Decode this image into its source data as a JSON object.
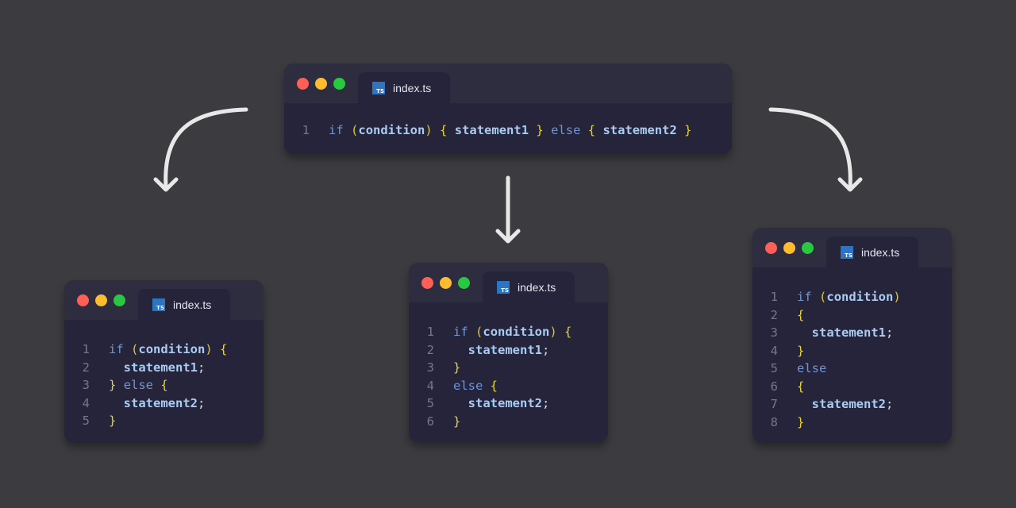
{
  "tab_label": "index.ts",
  "ts_badge": "TS",
  "source": {
    "lines": [
      {
        "n": "1",
        "kw1": "if",
        "p1": "(",
        "cond": "condition",
        "p2": ")",
        "b1": "{",
        "s1": "statement1",
        "b2": "}",
        "kw2": "else",
        "b3": "{",
        "s2": "statement2",
        "b4": "}"
      }
    ]
  },
  "styles": [
    {
      "lines": [
        {
          "n": "1",
          "tokens": [
            [
              "kw",
              "if"
            ],
            [
              "sp",
              " "
            ],
            [
              "paren",
              "("
            ],
            [
              "id",
              "condition"
            ],
            [
              "paren",
              ")"
            ],
            [
              "sp",
              " "
            ],
            [
              "brace",
              "{"
            ]
          ]
        },
        {
          "n": "2",
          "tokens": [
            [
              "sp",
              "  "
            ],
            [
              "id",
              "statement1"
            ],
            [
              "semi",
              ";"
            ]
          ]
        },
        {
          "n": "3",
          "tokens": [
            [
              "brace",
              "}"
            ],
            [
              "sp",
              " "
            ],
            [
              "kw",
              "else"
            ],
            [
              "sp",
              " "
            ],
            [
              "brace",
              "{"
            ]
          ]
        },
        {
          "n": "4",
          "tokens": [
            [
              "sp",
              "  "
            ],
            [
              "id",
              "statement2"
            ],
            [
              "semi",
              ";"
            ]
          ]
        },
        {
          "n": "5",
          "tokens": [
            [
              "brace",
              "}"
            ]
          ]
        }
      ]
    },
    {
      "lines": [
        {
          "n": "1",
          "tokens": [
            [
              "kw",
              "if"
            ],
            [
              "sp",
              " "
            ],
            [
              "paren",
              "("
            ],
            [
              "id",
              "condition"
            ],
            [
              "paren",
              ")"
            ],
            [
              "sp",
              " "
            ],
            [
              "brace",
              "{"
            ]
          ]
        },
        {
          "n": "2",
          "tokens": [
            [
              "sp",
              "  "
            ],
            [
              "id",
              "statement1"
            ],
            [
              "semi",
              ";"
            ]
          ]
        },
        {
          "n": "3",
          "tokens": [
            [
              "brace",
              "}"
            ]
          ]
        },
        {
          "n": "4",
          "tokens": [
            [
              "kw",
              "else"
            ],
            [
              "sp",
              " "
            ],
            [
              "brace",
              "{"
            ]
          ]
        },
        {
          "n": "5",
          "tokens": [
            [
              "sp",
              "  "
            ],
            [
              "id",
              "statement2"
            ],
            [
              "semi",
              ";"
            ]
          ]
        },
        {
          "n": "6",
          "tokens": [
            [
              "brace",
              "}"
            ]
          ]
        }
      ]
    },
    {
      "lines": [
        {
          "n": "1",
          "tokens": [
            [
              "kw",
              "if"
            ],
            [
              "sp",
              " "
            ],
            [
              "paren",
              "("
            ],
            [
              "id",
              "condition"
            ],
            [
              "paren",
              ")"
            ]
          ]
        },
        {
          "n": "2",
          "tokens": [
            [
              "brace",
              "{"
            ]
          ]
        },
        {
          "n": "3",
          "tokens": [
            [
              "sp",
              "  "
            ],
            [
              "id",
              "statement1"
            ],
            [
              "semi",
              ";"
            ]
          ]
        },
        {
          "n": "4",
          "tokens": [
            [
              "brace",
              "}"
            ]
          ]
        },
        {
          "n": "5",
          "tokens": [
            [
              "kw",
              "else"
            ]
          ]
        },
        {
          "n": "6",
          "tokens": [
            [
              "brace",
              "{"
            ]
          ]
        },
        {
          "n": "7",
          "tokens": [
            [
              "sp",
              "  "
            ],
            [
              "id",
              "statement2"
            ],
            [
              "semi",
              ";"
            ]
          ]
        },
        {
          "n": "8",
          "tokens": [
            [
              "brace",
              "}"
            ]
          ]
        }
      ]
    }
  ],
  "colors": {
    "background": "#3c3b3f",
    "window": "#25243a",
    "titlebar": "#2e2d40",
    "keyword": "#6f95d4",
    "identifier": "#a9ccf3",
    "brace": "#e7d631",
    "arrow": "#e8e8e8"
  },
  "icons": [
    "window-close-dot",
    "window-minimize-dot",
    "window-maximize-dot",
    "typescript-file-icon",
    "arrow-down-icon",
    "curved-arrow-left-icon",
    "curved-arrow-right-icon"
  ]
}
